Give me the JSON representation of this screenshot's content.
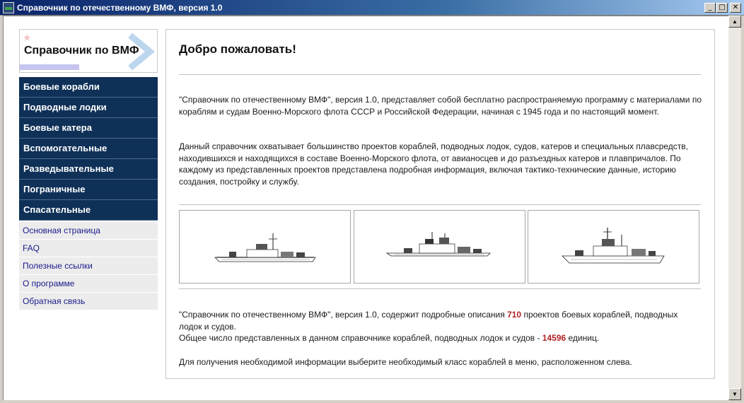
{
  "window": {
    "title": "Справочник по отечественному ВМФ, версия 1.0",
    "minimize_glyph": "_",
    "maximize_glyph": "□",
    "close_glyph": "✕"
  },
  "logo": {
    "text": "Справочник по ВМФ"
  },
  "menu": {
    "items": [
      {
        "label": "Боевые корабли"
      },
      {
        "label": "Подводные лодки"
      },
      {
        "label": "Боевые катера"
      },
      {
        "label": "Вспомогательные"
      },
      {
        "label": "Разведывательные"
      },
      {
        "label": "Пограничные"
      },
      {
        "label": "Спасательные"
      }
    ]
  },
  "links": {
    "items": [
      {
        "label": "Основная страница"
      },
      {
        "label": "FAQ"
      },
      {
        "label": "Полезные ссылки"
      },
      {
        "label": "О программе"
      },
      {
        "label": "Обратная связь"
      }
    ]
  },
  "content": {
    "title": "Добро пожаловать!",
    "para1": "\"Справочник по отечественному ВМФ\", версия 1.0, представляет собой бесплатно распространяемую программу с материалами по кораблям и судам Военно-Морского флота СССР и Российской Федерации, начиная с 1945 года и по настоящий момент.",
    "para2": "Данный справочник охватывает большинство проектов кораблей, подводных лодок, судов, катеров и специальных плавсредств, находившихся и находящихся в составе Военно-Морского флота, от авианосцев и до разъездных катеров и плавпричалов. По каждому из представленных проектов представлена подробная информация, включая тактико-технические данные, историю создания, постройку и службу.",
    "stats": {
      "para3_before": "\"Справочник по отечественному ВМФ\", версия 1.0, содержит подробные описания ",
      "projects_count": "710",
      "para3_after": " проектов боевых кораблей, подводных лодок и судов.",
      "para4_before": "Общее число представленных в данном справочнике кораблей, подводных лодок и судов - ",
      "units_count": "14596",
      "para4_after": " единиц."
    },
    "para5": "Для получения необходимой информации выберите необходимый класс кораблей в меню, расположенном слева."
  },
  "colors": {
    "menu_bg": "#0f3158",
    "link_text": "#1a1a8a",
    "count_highlight": "#b22222"
  }
}
